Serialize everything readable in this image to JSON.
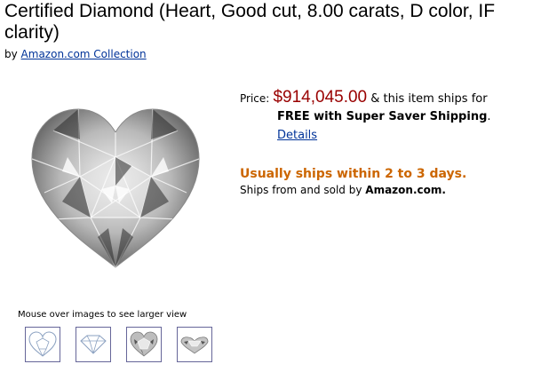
{
  "product": {
    "title": "Certified Diamond (Heart, Good cut, 8.00 carats, D color, IF clarity)",
    "by_prefix": "by",
    "brand_link": "Amazon.com Collection"
  },
  "pricing": {
    "label": "Price:",
    "price": "$914,045.00",
    "price_suffix": "& this item ships for",
    "free_shipping": "FREE with Super Saver Shipping",
    "free_shipping_period": ".",
    "details_link": "Details"
  },
  "availability": {
    "status": "Usually ships within 2 to 3 days.",
    "ships_from_prefix": "Ships from and sold by",
    "seller": "Amazon.com."
  },
  "gallery": {
    "hint": "Mouse over images to see larger view",
    "main_image_icon": "heart-diamond-image",
    "thumbnails": [
      {
        "icon": "heart-outline-diamond-icon"
      },
      {
        "icon": "round-outline-diamond-icon"
      },
      {
        "icon": "heart-diamond-photo-icon"
      },
      {
        "icon": "heart-diamond-side-photo-icon"
      }
    ]
  },
  "colors": {
    "price": "#990000",
    "availability": "#cc6600",
    "link": "#003399"
  }
}
